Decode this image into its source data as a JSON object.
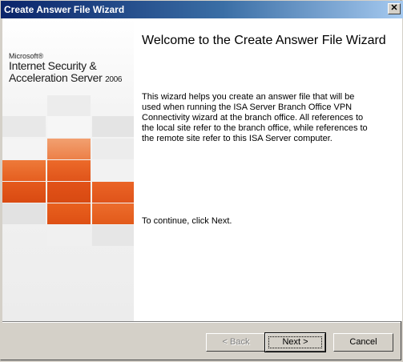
{
  "window": {
    "title": "Create Answer File Wizard",
    "close_glyph": "✕"
  },
  "branding": {
    "vendor": "Microsoft®",
    "product_line1": "Internet Security &",
    "product_line2": "Acceleration Server",
    "year": "2006"
  },
  "content": {
    "heading": "Welcome to the Create Answer File Wizard",
    "description": "This wizard helps you create an answer file that will be used when running the ISA Server Branch Office VPN Connectivity wizard at the branch office. All references to the local site refer to the branch office, while references to the remote site refer to this ISA Server computer.",
    "continue_text": "To continue, click Next."
  },
  "buttons": {
    "back": "< Back",
    "next": "Next >",
    "cancel": "Cancel"
  },
  "colors": {
    "orange_dark": "#e0501a",
    "orange_mid": "#ec7a3e",
    "orange_light": "#f2a070",
    "title_start": "#0a246a"
  }
}
